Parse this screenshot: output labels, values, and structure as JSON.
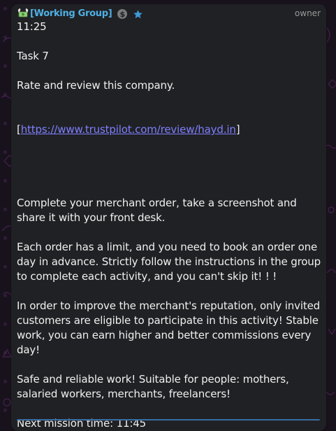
{
  "message": {
    "sender": "[Working Group]",
    "role": "owner",
    "time_top": "11:25",
    "task": "Task 7",
    "instruction": "Rate and review this company.",
    "link_open": "[",
    "link_text": "https://www.trustpilot.com/review/hayd.in",
    "link_close": "]",
    "paragraph_1": "Complete your merchant order, take a screenshot and share it with your front desk.",
    "paragraph_2": "Each order has a limit, and you need to book an order one day in advance. Strictly follow the instructions in the group to complete each activity, and you can't skip it! ! !",
    "paragraph_3": "In order to improve the merchant's reputation, only invited customers are eligible to participate in this activity! Stable work, you can earn higher and better commissions every day!",
    "paragraph_4": "Safe and reliable work! Suitable for people: mothers, salaried workers, merchants, freelancers!",
    "next_mission": "Next mission time: 11:45"
  },
  "icons": {
    "sender_emoji": "money-wings-icon",
    "dollar": "dollar-badge-icon",
    "star": "star-icon"
  },
  "colors": {
    "background": "#18121c",
    "bubble": "#202124",
    "sender": "#4fb0e6",
    "link": "#7f7fff",
    "text": "#f0f0f0"
  }
}
